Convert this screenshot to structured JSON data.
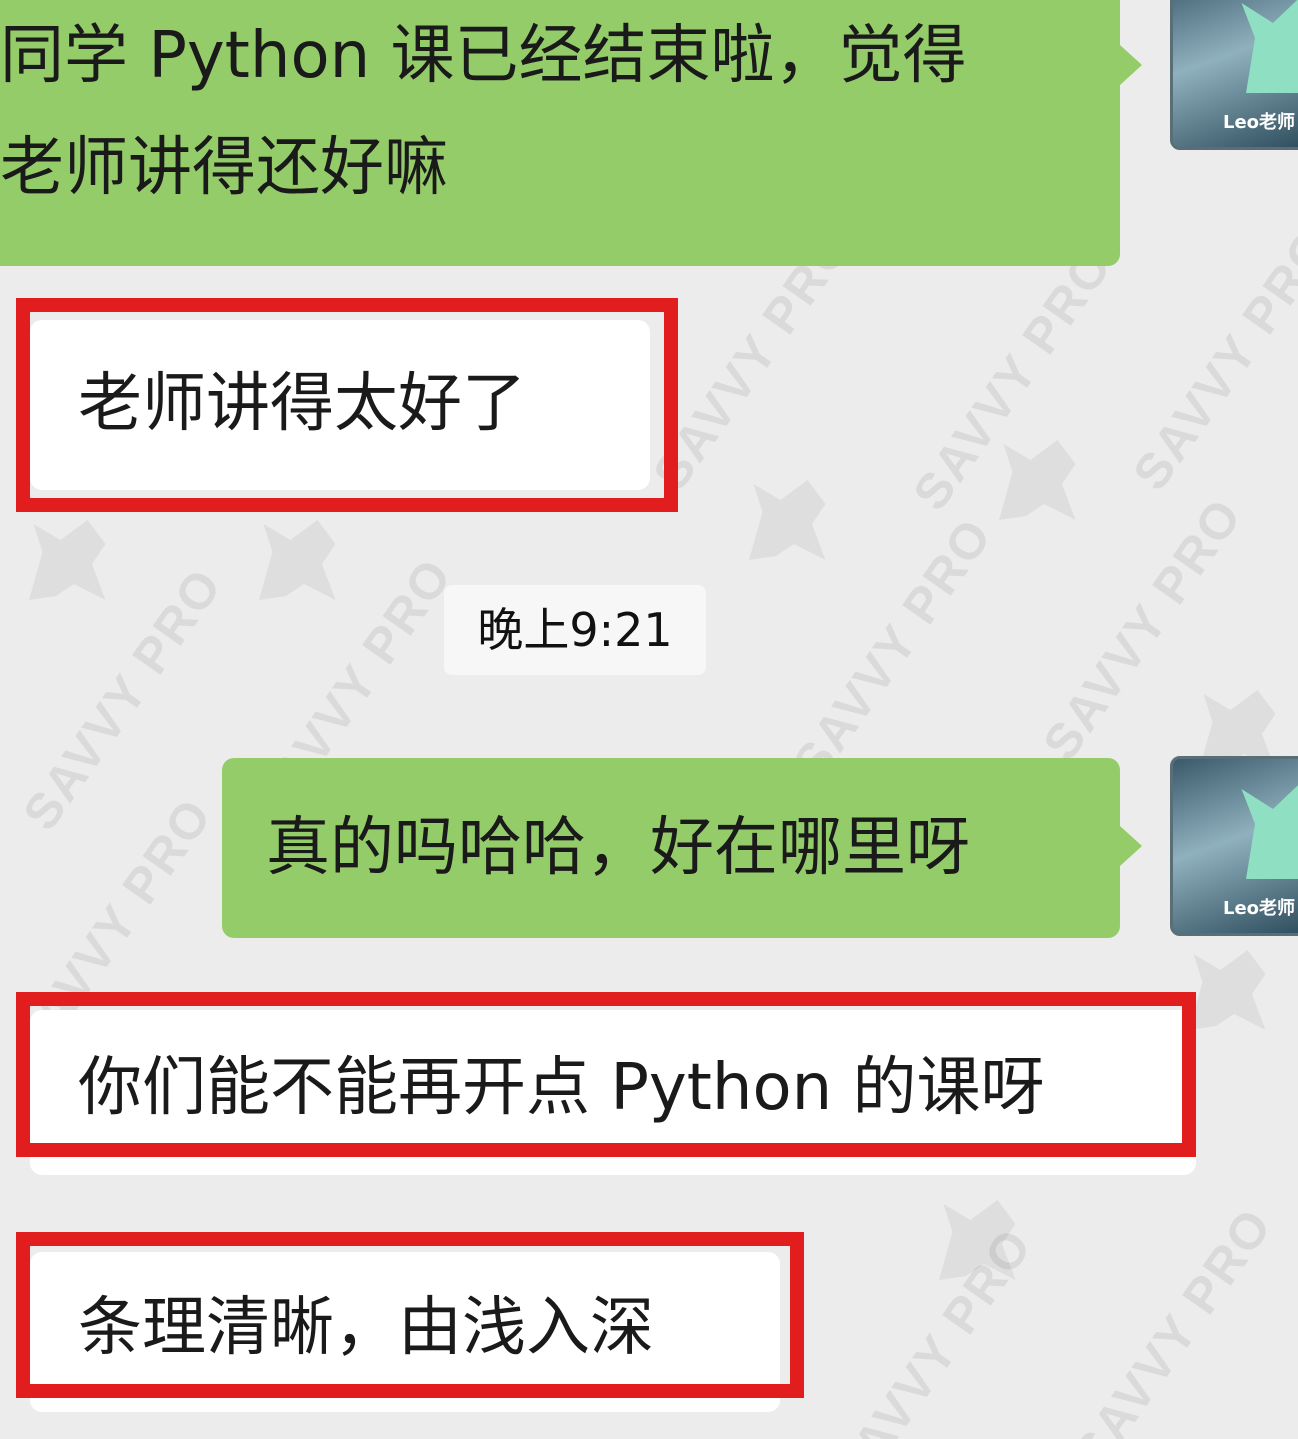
{
  "watermark": {
    "text": "SAVVY PRO"
  },
  "messages": {
    "m1": {
      "text_line1": "同学 Python 课已经结束啦，觉得",
      "text_line2": "老师讲得还好嘛"
    },
    "m2": {
      "text": "老师讲得太好了"
    },
    "time_label": "晚上9:21",
    "m3": {
      "text": "真的吗哈哈，好在哪里呀"
    },
    "m4": {
      "text": "你们能不能再开点 Python 的课呀"
    },
    "m5": {
      "text": "条理清晰，由浅入深"
    }
  },
  "avatar": {
    "caption": "Leo老师"
  },
  "colors": {
    "sent_bubble": "#95cc6a",
    "received_bubble": "#ffffff",
    "highlight_box": "#e21d1d",
    "background": "#ececec"
  }
}
